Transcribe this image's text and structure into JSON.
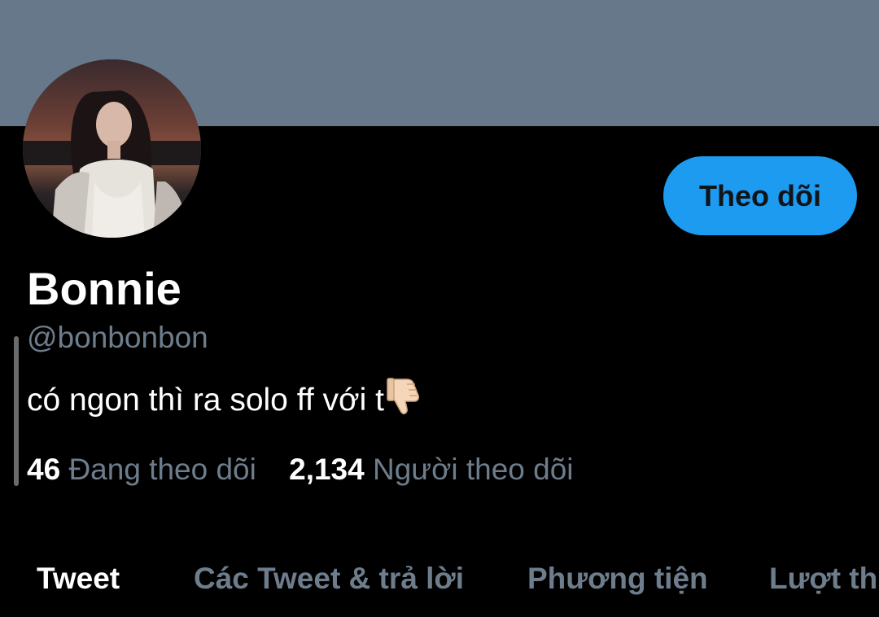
{
  "profile": {
    "name": "Bonnie",
    "handle": "@bonbonbon",
    "bio": "có ngon thì ra solo ff với t",
    "bio_emoji": "thumbs-down-emoji"
  },
  "follow_button": {
    "label": "Theo dõi"
  },
  "stats": {
    "following_count": "46",
    "following_label": "Đang theo dõi",
    "followers_count": "2,134",
    "followers_label": "Người theo dõi"
  },
  "tabs": [
    {
      "label": "Tweet",
      "active": true
    },
    {
      "label": "Các Tweet & trả lời",
      "active": false
    },
    {
      "label": "Phương tiện",
      "active": false
    },
    {
      "label": "Lượt thích",
      "active": false
    }
  ],
  "colors": {
    "banner": "#66788a",
    "accent": "#1d9bf0",
    "background": "#000000",
    "secondary_text": "#6e7d8c"
  }
}
